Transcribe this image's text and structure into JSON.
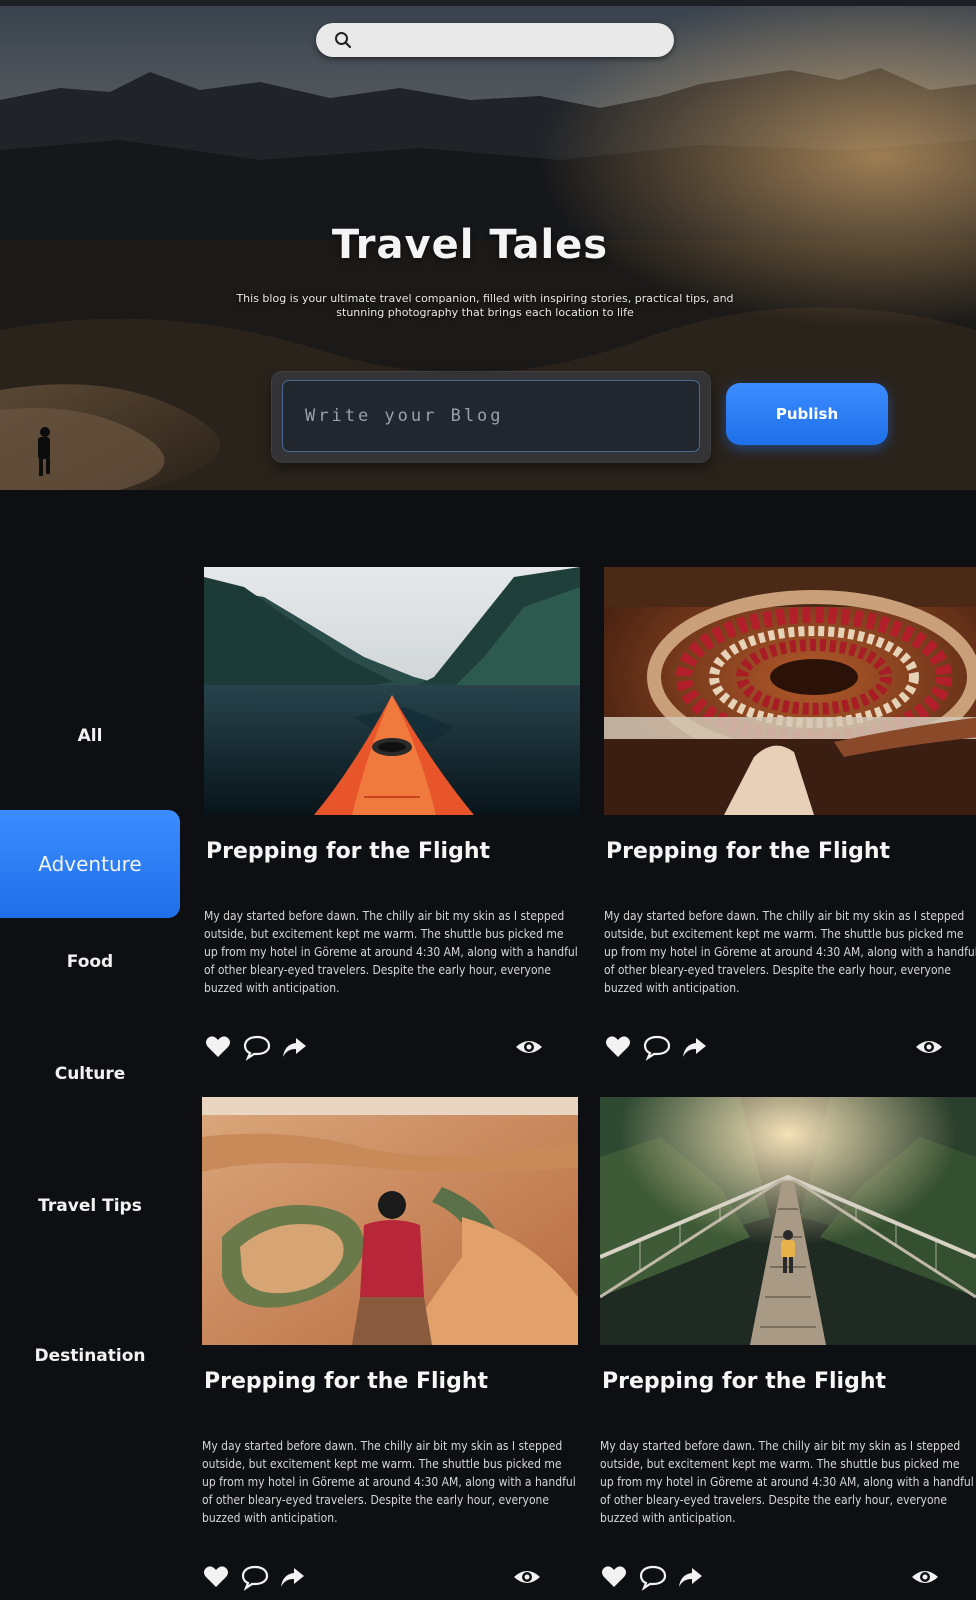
{
  "search": {
    "placeholder": ""
  },
  "hero": {
    "title": "Travel Tales",
    "description": "This blog is your ultimate travel companion, filled with inspiring stories, practical tips, and stunning photography that brings each location to life",
    "blog_placeholder": "Write your Blog",
    "publish_label": "Publish"
  },
  "sidebar": {
    "items": [
      {
        "label": "All",
        "active": false
      },
      {
        "label": "Adventure",
        "active": true
      },
      {
        "label": "Food",
        "active": false
      },
      {
        "label": "Culture",
        "active": false
      },
      {
        "label": "Travel Tips",
        "active": false
      },
      {
        "label": "Destination",
        "active": false
      }
    ]
  },
  "posts": [
    {
      "title": "Prepping for the Flight",
      "excerpt": "My day started before dawn. The chilly air bit my skin as I stepped outside, but excitement kept me warm. The shuttle bus picked me up from my hotel in Göreme at around 4:30 AM, along with a handful of other bleary-eyed travelers. Despite the early hour, everyone buzzed with anticipation.",
      "image": "kayak-in-fjord"
    },
    {
      "title": "Prepping for the Flight",
      "excerpt": "My day started before dawn. The chilly air bit my skin as I stepped outside, but excitement kept me warm. The shuttle bus picked me up from my hotel in Göreme at around 4:30 AM, along with a handful of other bleary-eyed travelers. Despite the early hour, everyone buzzed with anticipation.",
      "image": "spiral-staircase"
    },
    {
      "title": "Prepping for the Flight",
      "excerpt": "My day started before dawn. The chilly air bit my skin as I stepped outside, but excitement kept me warm. The shuttle bus picked me up from my hotel in Göreme at around 4:30 AM, along with a handful of other bleary-eyed travelers. Despite the early hour, everyone buzzed with anticipation.",
      "image": "canyon-overlook"
    },
    {
      "title": "Prepping for the Flight",
      "excerpt": "My day started before dawn. The chilly air bit my skin as I stepped outside, but excitement kept me warm. The shuttle bus picked me up from my hotel in Göreme at around 4:30 AM, along with a handful of other bleary-eyed travelers. Despite the early hour, everyone buzzed with anticipation.",
      "image": "suspension-bridge"
    }
  ],
  "icons": {
    "like": "heart-icon",
    "comment": "comment-icon",
    "share": "share-icon",
    "views": "eye-icon",
    "search": "search-icon"
  },
  "colors": {
    "accent": "#2f80f5",
    "background": "#0e0f12",
    "text": "#f4f4f4"
  }
}
